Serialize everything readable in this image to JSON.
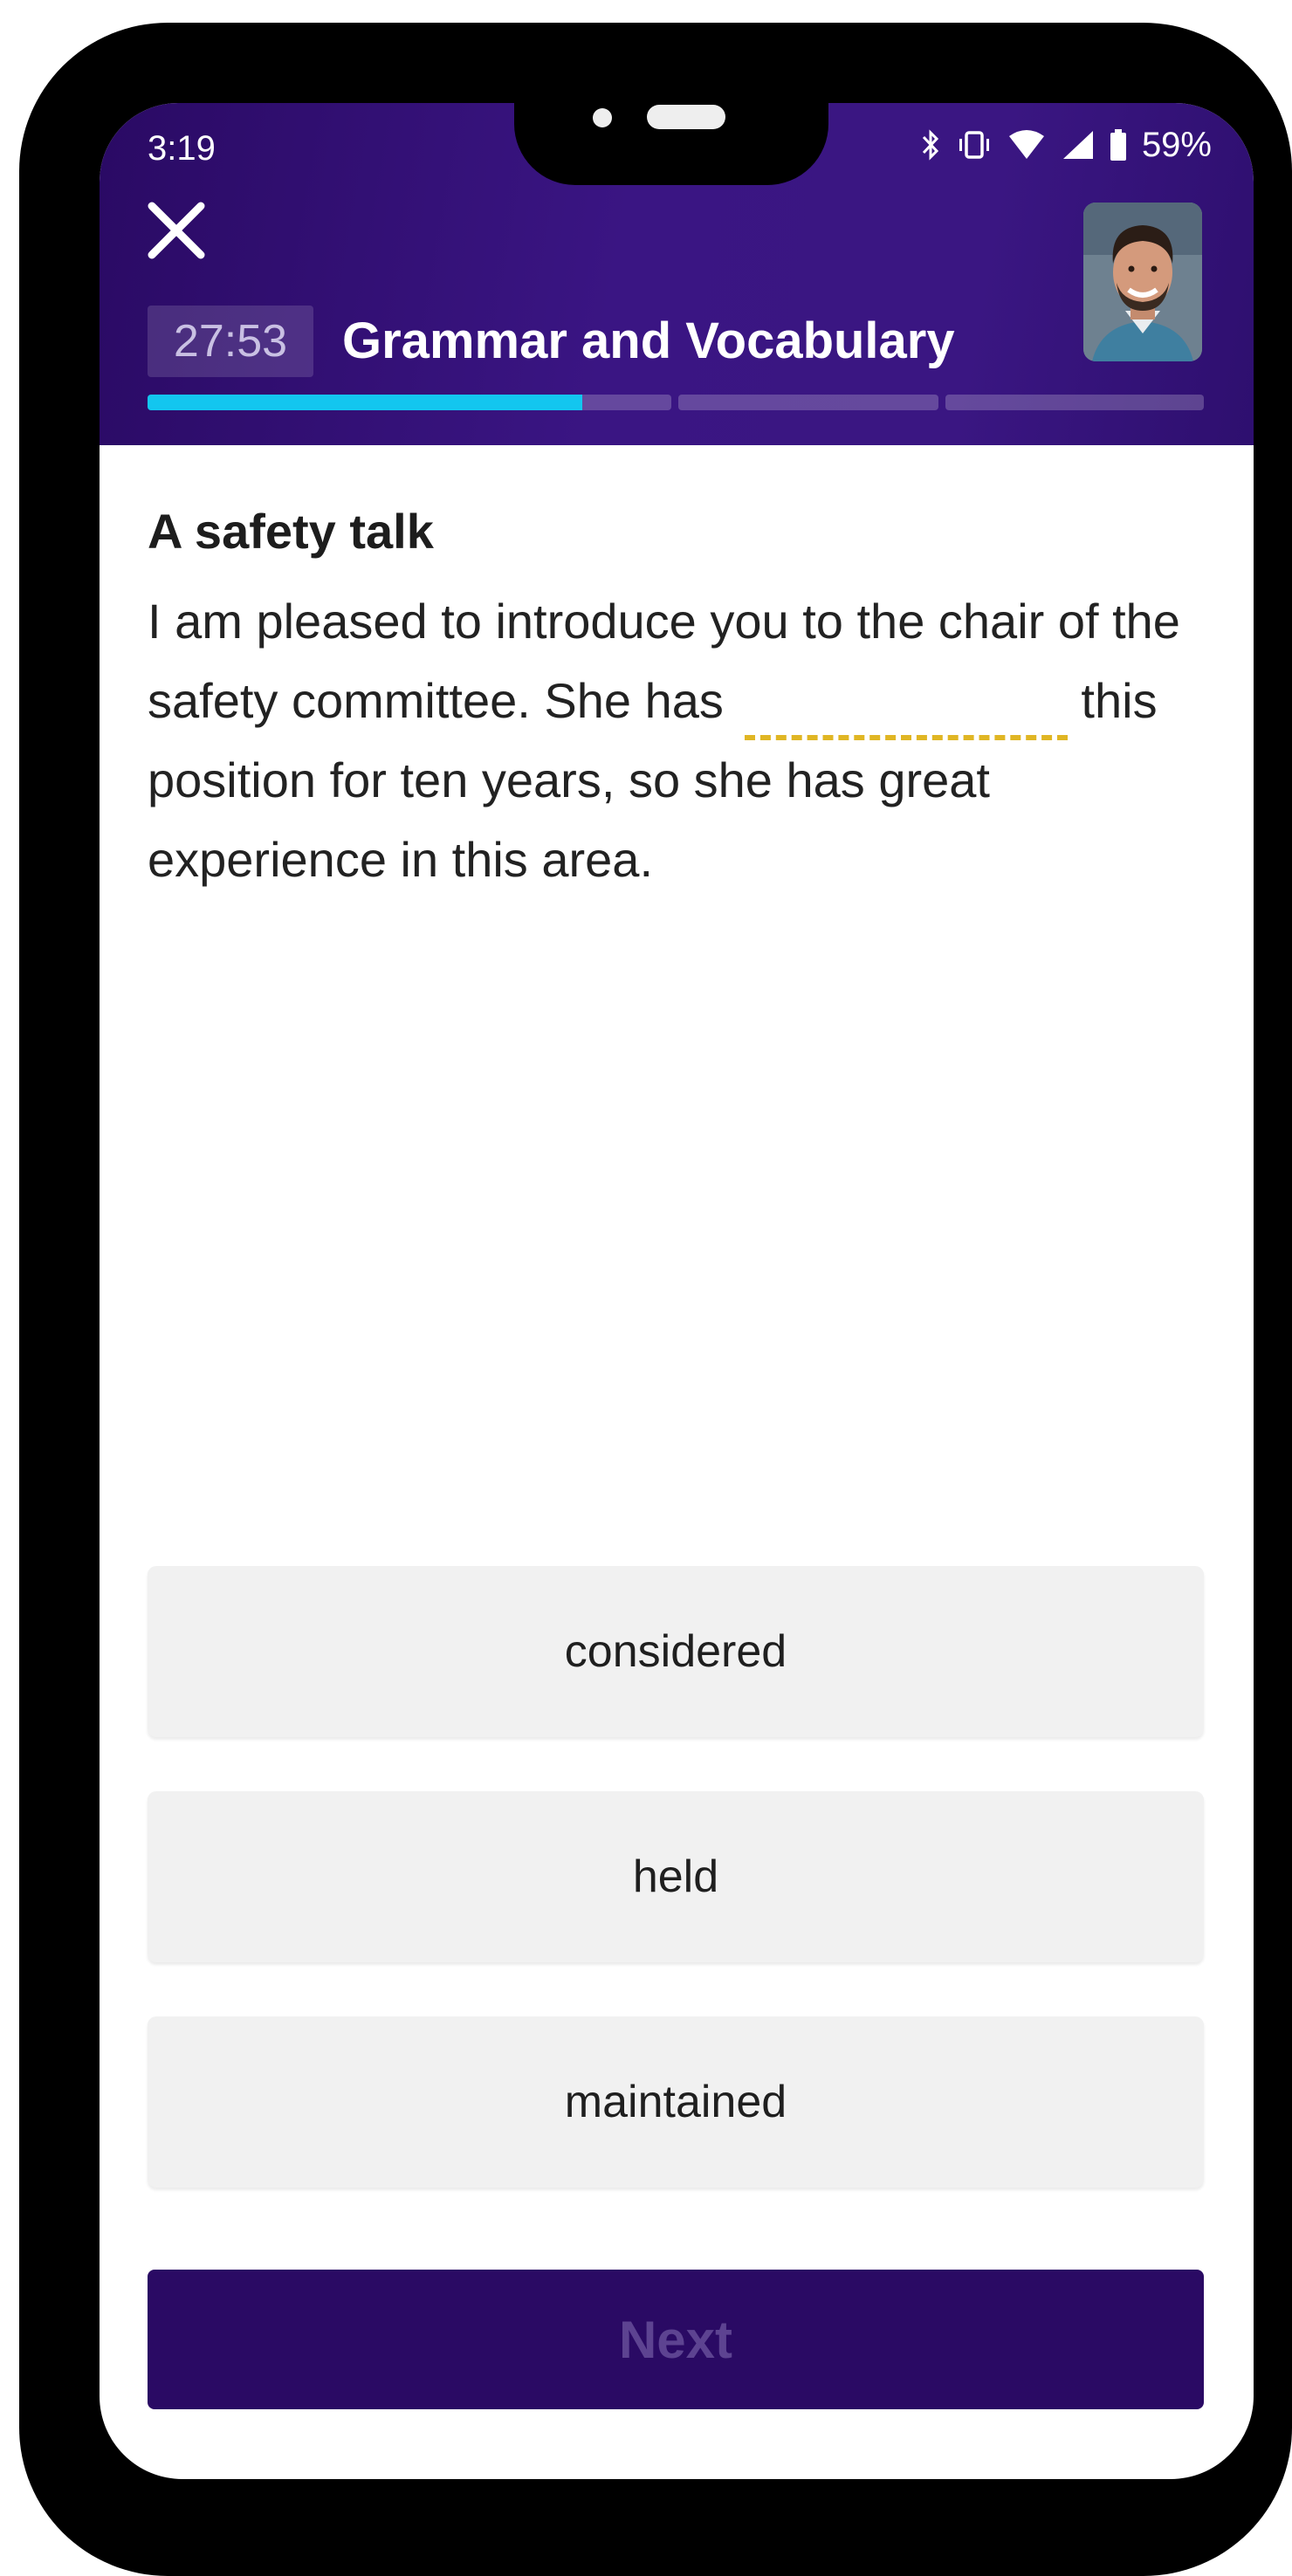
{
  "status_bar": {
    "time": "3:19",
    "battery": "59%",
    "icons": [
      "bluetooth-icon",
      "vibrate-icon",
      "wifi-icon",
      "signal-icon",
      "battery-icon"
    ]
  },
  "header": {
    "timer": "27:53",
    "title": "Grammar and Vocabulary",
    "close_icon": "close-icon",
    "progress": {
      "segments": 3,
      "current_segment_fill": 0.83,
      "segments_complete": 0
    }
  },
  "question": {
    "heading": "A safety talk",
    "text_before": "I am pleased to introduce you to the chair of the safety committee. She has",
    "text_after": "this position for ten years, so she has great experience in this area."
  },
  "options": [
    {
      "label": "considered"
    },
    {
      "label": "held"
    },
    {
      "label": "maintained"
    }
  ],
  "actions": {
    "next_label": "Next"
  },
  "colors": {
    "header": "#3a1583",
    "progress_fill": "#13c6ef",
    "blank_underline": "#e0b624",
    "next_button": "#2a0a64"
  }
}
